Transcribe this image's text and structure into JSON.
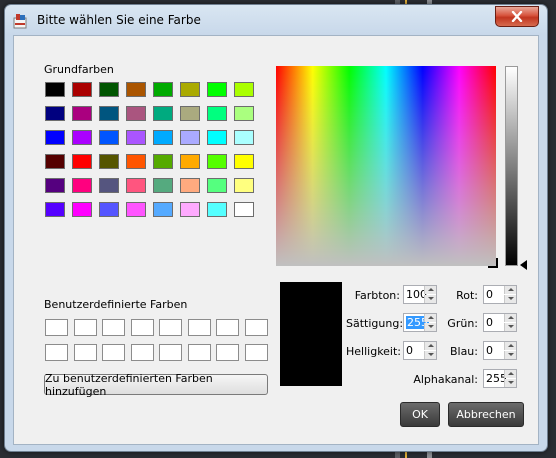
{
  "window": {
    "title": "Bitte wählen Sie eine Farbe",
    "close_icon": "close-icon"
  },
  "basic_colors": {
    "label": "Grundfarben",
    "rows": [
      [
        "#000000",
        "#aa0000",
        "#005500",
        "#aa5500",
        "#00aa00",
        "#aaaa00",
        "#00ff00",
        "#aaff00"
      ],
      [
        "#00007f",
        "#aa007f",
        "#00557f",
        "#aa557f",
        "#00aa7f",
        "#aaaa7f",
        "#00ff7f",
        "#aaff7f"
      ],
      [
        "#0000ff",
        "#aa00ff",
        "#0055ff",
        "#aa55ff",
        "#00aaff",
        "#aaaaff",
        "#00ffff",
        "#aaffff"
      ],
      [
        "#550000",
        "#ff0000",
        "#555500",
        "#ff5500",
        "#55aa00",
        "#ffaa00",
        "#55ff00",
        "#ffff00"
      ],
      [
        "#55007f",
        "#ff007f",
        "#55557f",
        "#ff557f",
        "#55aa7f",
        "#ffaa7f",
        "#55ff7f",
        "#ffff7f"
      ],
      [
        "#5500ff",
        "#ff00ff",
        "#5555ff",
        "#ff55ff",
        "#55aaff",
        "#ffaaff",
        "#55ffff",
        "#ffffff"
      ]
    ]
  },
  "custom_colors": {
    "label": "Benutzerdefinierte Farben",
    "rows": 2,
    "cols": 8,
    "add_button": "Zu benutzerdefinierten Farben hinzufügen"
  },
  "fields": {
    "farbton": {
      "label": "Farbton:",
      "value": "100"
    },
    "saettigung": {
      "label": "Sättigung:",
      "value": "255"
    },
    "helligkeit": {
      "label": "Helligkeit:",
      "value": "0"
    },
    "rot": {
      "label": "Rot:",
      "value": "0"
    },
    "gruen": {
      "label": "Grün:",
      "value": "0"
    },
    "blau": {
      "label": "Blau:",
      "value": "0"
    },
    "alphakanal": {
      "label": "Alphakanal:",
      "value": "255"
    }
  },
  "current_color": "#000000",
  "buttons": {
    "ok": "OK",
    "cancel": "Abbrechen"
  }
}
